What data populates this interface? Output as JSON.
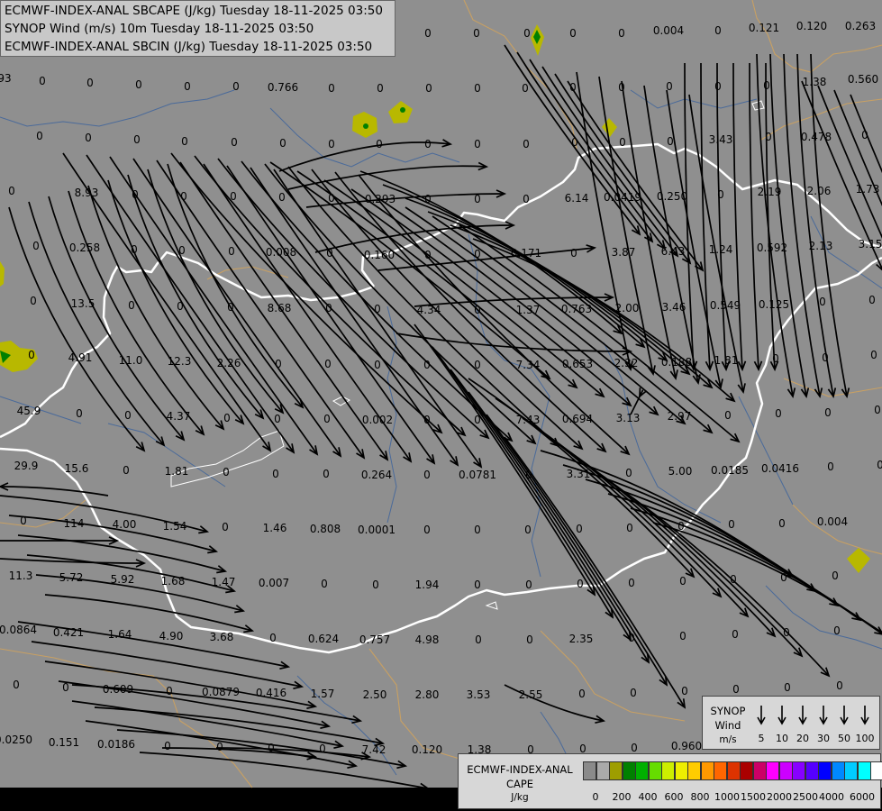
{
  "header": {
    "line1": "ECMWF-INDEX-ANAL SBCAPE (J/kg) Tuesday 18-11-2025 03:50",
    "line2": "SYNOP Wind (m/s) 10m Tuesday 18-11-2025 03:50",
    "line3": "ECMWF-INDEX-ANAL SBCIN (J/kg) Tuesday 18-11-2025 03:50"
  },
  "synop_legend": {
    "title1": "SYNOP",
    "title2": "Wind",
    "unit": "m/s",
    "speeds": [
      "5",
      "10",
      "20",
      "30",
      "50",
      "100"
    ]
  },
  "cape_legend": {
    "title1": "ECMWF-INDEX-ANAL",
    "title2": "CAPE",
    "unit": "J/kg",
    "colors": [
      "#8a8a8a",
      "#aaaaaa",
      "#9e9e00",
      "#008000",
      "#00b000",
      "#66dd00",
      "#ccee00",
      "#eeee00",
      "#ffcc00",
      "#ff9900",
      "#ff6600",
      "#dd3300",
      "#aa0000",
      "#cc0066",
      "#ff00ff",
      "#cc00ff",
      "#8800ff",
      "#5500ff",
      "#0000ff",
      "#0088ff",
      "#00ccff",
      "#00ffff",
      "#ffffff"
    ],
    "ticks": [
      "0",
      "200",
      "400",
      "600",
      "800",
      "1000",
      "1500",
      "2000",
      "2500",
      "4000",
      "6000"
    ]
  },
  "colors": {
    "map_background": "#8f8f8f",
    "border": "#ffffff",
    "rivers": "#4a6a9a",
    "regions": "#c8a063",
    "streamlines": "#000000",
    "cape_cells": "#b8b800"
  },
  "values": [
    [
      "0",
      100,
      37
    ],
    [
      "0",
      148,
      37
    ],
    [
      "0",
      196,
      37
    ],
    [
      "0",
      255,
      37
    ],
    [
      "0",
      311,
      37
    ],
    [
      "0",
      370,
      37
    ],
    [
      "0",
      422,
      37
    ],
    [
      "0",
      475,
      37
    ],
    [
      "0",
      529,
      37
    ],
    [
      "0",
      585,
      37
    ],
    [
      "0",
      636,
      37
    ],
    [
      "0",
      690,
      37
    ],
    [
      "0.004",
      742,
      34
    ],
    [
      "0",
      797,
      34
    ],
    [
      "0.121",
      848,
      31
    ],
    [
      "0.120",
      901,
      29
    ],
    [
      "0.263",
      955,
      29
    ],
    [
      "93",
      5,
      87
    ],
    [
      "0",
      47,
      90
    ],
    [
      "0",
      100,
      92
    ],
    [
      "0",
      154,
      94
    ],
    [
      "0",
      208,
      96
    ],
    [
      "0",
      262,
      96
    ],
    [
      "0.766",
      314,
      97
    ],
    [
      "0",
      368,
      98
    ],
    [
      "0",
      422,
      98
    ],
    [
      "0",
      476,
      98
    ],
    [
      "0",
      530,
      98
    ],
    [
      "0",
      583,
      98
    ],
    [
      "0",
      636,
      97
    ],
    [
      "0",
      690,
      97
    ],
    [
      "0",
      743,
      96
    ],
    [
      "0",
      797,
      96
    ],
    [
      "0",
      851,
      95
    ],
    [
      "1.38",
      904,
      91
    ],
    [
      "0.560",
      958,
      88
    ],
    [
      "0",
      44,
      151
    ],
    [
      "0",
      98,
      153
    ],
    [
      "0",
      152,
      155
    ],
    [
      "0",
      205,
      157
    ],
    [
      "0",
      260,
      158
    ],
    [
      "0",
      314,
      159
    ],
    [
      "0",
      368,
      160
    ],
    [
      "0",
      421,
      160
    ],
    [
      "0",
      475,
      160
    ],
    [
      "0",
      530,
      160
    ],
    [
      "0",
      584,
      160
    ],
    [
      "0",
      638,
      158
    ],
    [
      "0",
      691,
      158
    ],
    [
      "0",
      744,
      157
    ],
    [
      "3.43",
      800,
      155
    ],
    [
      "0",
      853,
      152
    ],
    [
      "0.478",
      906,
      152
    ],
    [
      "0",
      960,
      150
    ],
    [
      "0",
      13,
      212
    ],
    [
      "8.93",
      96,
      214
    ],
    [
      "0",
      150,
      216
    ],
    [
      "0",
      204,
      218
    ],
    [
      "0",
      259,
      218
    ],
    [
      "0",
      313,
      219
    ],
    [
      "0",
      368,
      220
    ],
    [
      "0.293",
      422,
      221
    ],
    [
      "0",
      475,
      221
    ],
    [
      "0",
      530,
      221
    ],
    [
      "0",
      584,
      221
    ],
    [
      "6.14",
      640,
      220
    ],
    [
      "0.0419",
      691,
      219
    ],
    [
      "0.250",
      746,
      218
    ],
    [
      "0",
      800,
      216
    ],
    [
      "2.19",
      854,
      213
    ],
    [
      "2.06",
      909,
      212
    ],
    [
      "1.73",
      963,
      210
    ],
    [
      "0",
      40,
      273
    ],
    [
      "0.258",
      94,
      275
    ],
    [
      "0",
      149,
      277
    ],
    [
      "0",
      202,
      278
    ],
    [
      "0",
      257,
      279
    ],
    [
      "0.008",
      312,
      280
    ],
    [
      "0",
      366,
      281
    ],
    [
      "0.160",
      421,
      283
    ],
    [
      "0",
      475,
      283
    ],
    [
      "0",
      530,
      282
    ],
    [
      "0.171",
      584,
      281
    ],
    [
      "0",
      637,
      281
    ],
    [
      "3.87",
      692,
      280
    ],
    [
      "6.43",
      747,
      279
    ],
    [
      "1.24",
      800,
      277
    ],
    [
      "0.592",
      857,
      275
    ],
    [
      "2.13",
      911,
      273
    ],
    [
      "3.15",
      966,
      271
    ],
    [
      "0",
      37,
      334
    ],
    [
      "13.5",
      92,
      337
    ],
    [
      "0",
      146,
      339
    ],
    [
      "0",
      200,
      340
    ],
    [
      "0",
      256,
      341
    ],
    [
      "8.68",
      310,
      342
    ],
    [
      "0",
      365,
      342
    ],
    [
      "0",
      419,
      343
    ],
    [
      "4.34",
      476,
      344
    ],
    [
      "0",
      530,
      344
    ],
    [
      "1.37",
      586,
      344
    ],
    [
      "0.763",
      640,
      343
    ],
    [
      "2.00",
      696,
      342
    ],
    [
      "3.46",
      748,
      341
    ],
    [
      "0.549",
      805,
      339
    ],
    [
      "0.125",
      859,
      338
    ],
    [
      "0",
      913,
      335
    ],
    [
      "0",
      968,
      333
    ],
    [
      "0",
      35,
      394
    ],
    [
      "4.91",
      89,
      397
    ],
    [
      "11.0",
      145,
      400
    ],
    [
      "12.3",
      199,
      401
    ],
    [
      "2.26",
      254,
      403
    ],
    [
      "0",
      309,
      404
    ],
    [
      "0",
      364,
      404
    ],
    [
      "0",
      419,
      405
    ],
    [
      "0",
      474,
      405
    ],
    [
      "0",
      530,
      405
    ],
    [
      "7.34",
      586,
      405
    ],
    [
      "0.653",
      641,
      404
    ],
    [
      "2.32",
      695,
      403
    ],
    [
      "0.188",
      751,
      402
    ],
    [
      "1.81",
      806,
      400
    ],
    [
      "0",
      861,
      398
    ],
    [
      "0",
      916,
      397
    ],
    [
      "0",
      970,
      394
    ],
    [
      "45.9",
      32,
      456
    ],
    [
      "0",
      88,
      459
    ],
    [
      "0",
      142,
      461
    ],
    [
      "4.37",
      198,
      462
    ],
    [
      "0",
      252,
      464
    ],
    [
      "0",
      308,
      465
    ],
    [
      "0",
      363,
      465
    ],
    [
      "0.002",
      419,
      466
    ],
    [
      "0",
      474,
      466
    ],
    [
      "0",
      530,
      466
    ],
    [
      "7.43",
      586,
      466
    ],
    [
      "0.694",
      641,
      465
    ],
    [
      "3.13",
      697,
      464
    ],
    [
      "2.97",
      754,
      462
    ],
    [
      "0",
      808,
      461
    ],
    [
      "0",
      864,
      459
    ],
    [
      "0",
      919,
      458
    ],
    [
      "0",
      974,
      455
    ],
    [
      "29.9",
      29,
      517
    ],
    [
      "15.6",
      85,
      520
    ],
    [
      "0",
      140,
      522
    ],
    [
      "1.81",
      196,
      523
    ],
    [
      "0",
      251,
      524
    ],
    [
      "0",
      306,
      526
    ],
    [
      "0",
      362,
      526
    ],
    [
      "0.264",
      418,
      527
    ],
    [
      "0",
      474,
      527
    ],
    [
      "0.0781",
      530,
      527
    ],
    [
      "0",
      587,
      527
    ],
    [
      "3.31",
      642,
      526
    ],
    [
      "0",
      698,
      525
    ],
    [
      "5.00",
      755,
      523
    ],
    [
      "0.0185",
      810,
      522
    ],
    [
      "0.0416",
      866,
      520
    ],
    [
      "0",
      922,
      518
    ],
    [
      "0",
      977,
      516
    ],
    [
      "0",
      26,
      578
    ],
    [
      "114",
      82,
      581
    ],
    [
      "4.00",
      138,
      582
    ],
    [
      "1.54",
      194,
      584
    ],
    [
      "0",
      250,
      585
    ],
    [
      "1.46",
      305,
      586
    ],
    [
      "0.808",
      361,
      587
    ],
    [
      "0.0001",
      418,
      588
    ],
    [
      "0",
      474,
      588
    ],
    [
      "0",
      530,
      588
    ],
    [
      "0",
      586,
      588
    ],
    [
      "0",
      643,
      587
    ],
    [
      "0",
      699,
      586
    ],
    [
      "0",
      756,
      584
    ],
    [
      "0",
      812,
      582
    ],
    [
      "0",
      868,
      581
    ],
    [
      "0.004",
      924,
      579
    ],
    [
      "11.3",
      23,
      639
    ],
    [
      "5.72",
      79,
      641
    ],
    [
      "5.92",
      136,
      643
    ],
    [
      "1.68",
      192,
      645
    ],
    [
      "1.47",
      248,
      646
    ],
    [
      "0.007",
      304,
      647
    ],
    [
      "0",
      360,
      648
    ],
    [
      "0",
      417,
      649
    ],
    [
      "1.94",
      474,
      649
    ],
    [
      "0",
      530,
      649
    ],
    [
      "0",
      587,
      649
    ],
    [
      "0",
      644,
      648
    ],
    [
      "0",
      701,
      647
    ],
    [
      "0",
      758,
      645
    ],
    [
      "0",
      814,
      643
    ],
    [
      "0",
      870,
      641
    ],
    [
      "0",
      927,
      639
    ],
    [
      "0.0864",
      20,
      699
    ],
    [
      "0.421",
      76,
      702
    ],
    [
      "1.64",
      133,
      704
    ],
    [
      "4.90",
      190,
      706
    ],
    [
      "3.68",
      246,
      707
    ],
    [
      "0",
      303,
      708
    ],
    [
      "0.624",
      359,
      709
    ],
    [
      "0.757",
      416,
      710
    ],
    [
      "4.98",
      474,
      710
    ],
    [
      "0",
      531,
      710
    ],
    [
      "0",
      588,
      710
    ],
    [
      "2.35",
      645,
      709
    ],
    [
      "0",
      701,
      708
    ],
    [
      "0",
      758,
      706
    ],
    [
      "0",
      816,
      704
    ],
    [
      "0",
      873,
      702
    ],
    [
      "0",
      929,
      700
    ],
    [
      "0",
      18,
      760
    ],
    [
      "0",
      73,
      763
    ],
    [
      "0.609",
      131,
      765
    ],
    [
      "0",
      188,
      767
    ],
    [
      "0.0879",
      245,
      768
    ],
    [
      "0.416",
      301,
      769
    ],
    [
      "1.57",
      358,
      770
    ],
    [
      "2.50",
      416,
      771
    ],
    [
      "2.80",
      474,
      771
    ],
    [
      "3.53",
      531,
      771
    ],
    [
      "2.55",
      589,
      771
    ],
    [
      "0",
      646,
      770
    ],
    [
      "0",
      703,
      769
    ],
    [
      "0",
      760,
      767
    ],
    [
      "0",
      817,
      765
    ],
    [
      "0",
      874,
      763
    ],
    [
      "0",
      932,
      761
    ],
    [
      "0.0250",
      15,
      821
    ],
    [
      "0.151",
      71,
      824
    ],
    [
      "0.0186",
      129,
      826
    ],
    [
      "0",
      186,
      828
    ],
    [
      "0",
      244,
      829
    ],
    [
      "0",
      301,
      830
    ],
    [
      "0",
      358,
      831
    ],
    [
      "7.42",
      415,
      832
    ],
    [
      "0.120",
      474,
      832
    ],
    [
      "1.38",
      532,
      832
    ],
    [
      "0",
      589,
      832
    ],
    [
      "0",
      647,
      831
    ],
    [
      "0",
      704,
      830
    ],
    [
      "0.960",
      762,
      828
    ]
  ]
}
